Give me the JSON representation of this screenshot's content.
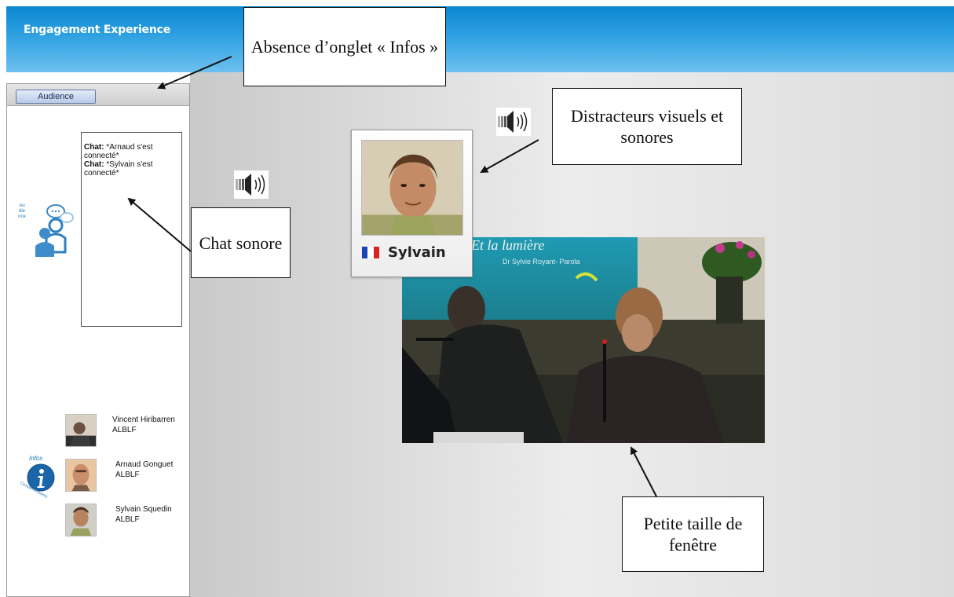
{
  "app": {
    "title": "Engagement Experience"
  },
  "panel": {
    "tabs": [
      {
        "label": "Audience"
      }
    ],
    "audience_label": "Audience",
    "chat": [
      {
        "prefix": "Chat:",
        "text": " *Arnaud s'est connecté*"
      },
      {
        "prefix": "Chat:",
        "text": " *Sylvain s'est connecté*"
      }
    ],
    "infos_label": "Infos",
    "infos_sublabel": "Complémentaires",
    "participants": [
      {
        "name": "Vincent Hiribarren",
        "org": "ALBLF"
      },
      {
        "name": "Arnaud Gonguet",
        "org": "ALBLF"
      },
      {
        "name": "Sylvain Squedin",
        "org": "ALBLF"
      }
    ]
  },
  "card": {
    "name": "Sylvain",
    "flag": "france-flag"
  },
  "video": {
    "title": "Et la lumière",
    "subtitle": "Dr Sylvie Royant- Parola"
  },
  "annotations": {
    "tab": "Absence d’onglet « Infos »",
    "chat": "Chat sonore",
    "distract": "Distracteurs visuels et sonores",
    "size": "Petite taille de fenêtre"
  },
  "colors": {
    "header": "#1a93d9",
    "stage": "#dcdcdc",
    "accent": "#1c79b7"
  }
}
